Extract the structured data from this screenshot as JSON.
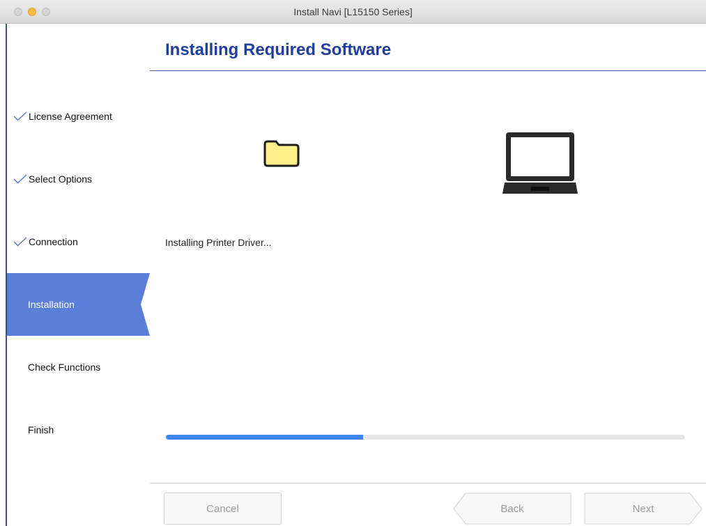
{
  "window": {
    "title": "Install Navi [L15150 Series]"
  },
  "sidebar": {
    "steps": [
      {
        "label": "License Agreement",
        "state": "completed"
      },
      {
        "label": "Select Options",
        "state": "completed"
      },
      {
        "label": "Connection",
        "state": "completed"
      },
      {
        "label": "Installation",
        "state": "current"
      },
      {
        "label": "Check Functions",
        "state": "pending"
      },
      {
        "label": "Finish",
        "state": "pending"
      }
    ]
  },
  "main": {
    "title": "Installing Required Software",
    "status": "Installing Printer Driver...",
    "progress_percent": 38,
    "icons": [
      "folder-icon",
      "laptop-icon"
    ]
  },
  "footer": {
    "cancel_label": "Cancel",
    "back_label": "Back",
    "next_label": "Next"
  },
  "colors": {
    "accent": "#5b7fd8",
    "title": "#1f3e9e",
    "progress": "#3d84ef",
    "check": "#5b74c8"
  }
}
